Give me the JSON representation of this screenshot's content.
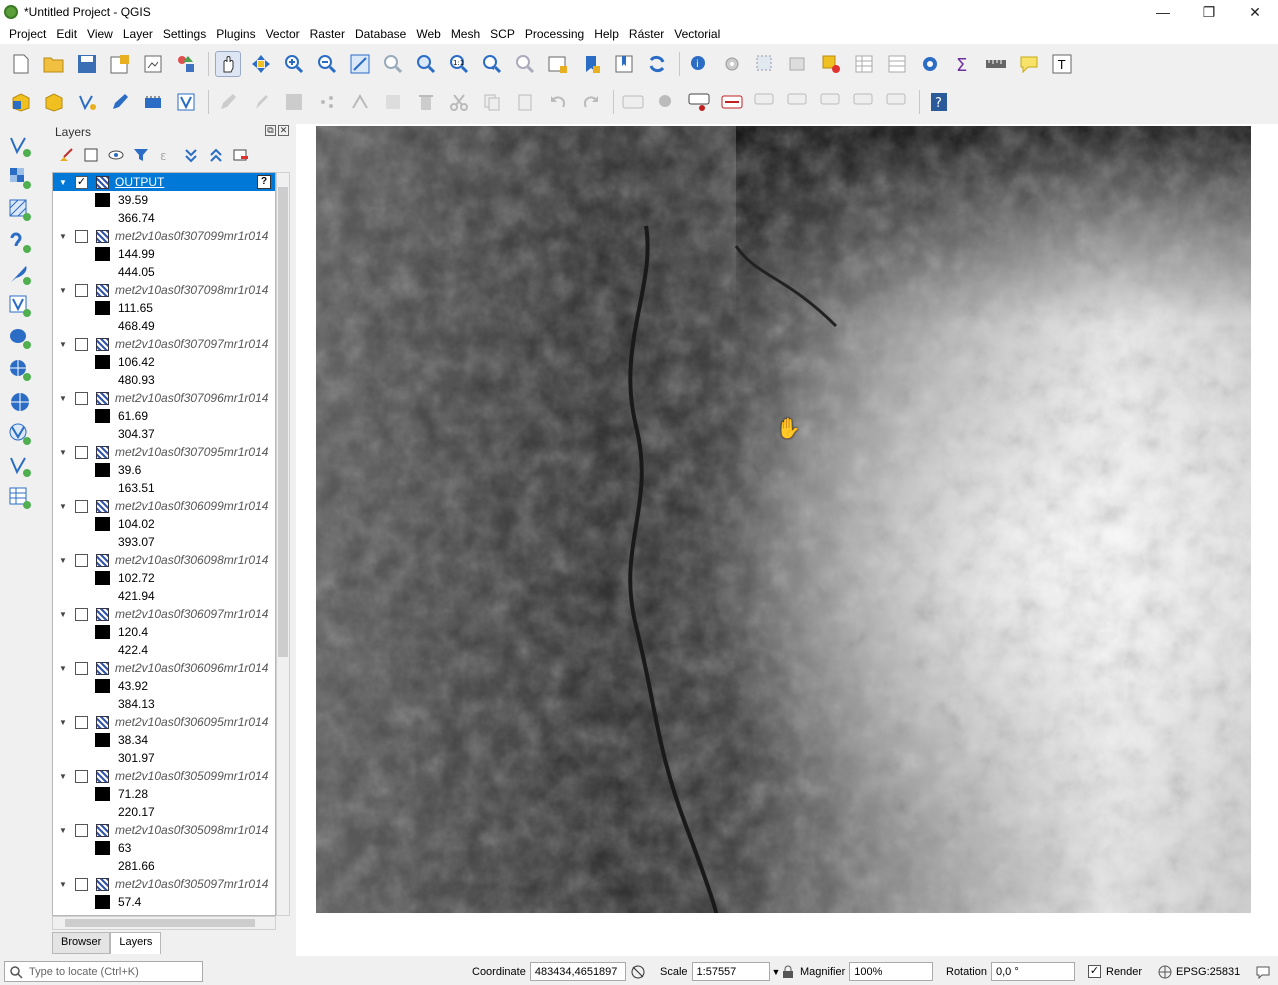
{
  "window": {
    "title": "*Untitled Project - QGIS",
    "minimize": "—",
    "restore": "❐",
    "close": "✕"
  },
  "menu": [
    "Project",
    "Edit",
    "View",
    "Layer",
    "Settings",
    "Plugins",
    "Vector",
    "Raster",
    "Database",
    "Web",
    "Mesh",
    "SCP",
    "Processing",
    "Help",
    "Ráster",
    "Vectorial"
  ],
  "panel": {
    "title": "Layers",
    "tabs": [
      "Browser",
      "Layers"
    ],
    "layers": [
      {
        "name": "OUTPUT",
        "checked": true,
        "selected": true,
        "min": "39.59",
        "max": "366.74"
      },
      {
        "name": "met2v10as0f307099mr1r014",
        "checked": false,
        "min": "144.99",
        "max": "444.05"
      },
      {
        "name": "met2v10as0f307098mr1r014",
        "checked": false,
        "min": "111.65",
        "max": "468.49"
      },
      {
        "name": "met2v10as0f307097mr1r014",
        "checked": false,
        "min": "106.42",
        "max": "480.93"
      },
      {
        "name": "met2v10as0f307096mr1r014",
        "checked": false,
        "min": "61.69",
        "max": "304.37"
      },
      {
        "name": "met2v10as0f307095mr1r014",
        "checked": false,
        "min": "39.6",
        "max": "163.51"
      },
      {
        "name": "met2v10as0f306099mr1r014",
        "checked": false,
        "min": "104.02",
        "max": "393.07"
      },
      {
        "name": "met2v10as0f306098mr1r014",
        "checked": false,
        "min": "102.72",
        "max": "421.94"
      },
      {
        "name": "met2v10as0f306097mr1r014",
        "checked": false,
        "min": "120.4",
        "max": "422.4"
      },
      {
        "name": "met2v10as0f306096mr1r014",
        "checked": false,
        "min": "43.92",
        "max": "384.13"
      },
      {
        "name": "met2v10as0f306095mr1r014",
        "checked": false,
        "min": "38.34",
        "max": "301.97"
      },
      {
        "name": "met2v10as0f305099mr1r014",
        "checked": false,
        "min": "71.28",
        "max": "220.17"
      },
      {
        "name": "met2v10as0f305098mr1r014",
        "checked": false,
        "min": "63",
        "max": "281.66"
      },
      {
        "name": "met2v10as0f305097mr1r014",
        "checked": false,
        "min": "57.4",
        "max": ""
      }
    ]
  },
  "status": {
    "locate_placeholder": "Type to locate (Ctrl+K)",
    "coordinate_label": "Coordinate",
    "coordinate_value": "483434,4651897",
    "scale_label": "Scale",
    "scale_value": "1:57557",
    "magnifier_label": "Magnifier",
    "magnifier_value": "100%",
    "rotation_label": "Rotation",
    "rotation_value": "0,0 °",
    "render_label": "Render",
    "crs": "EPSG:25831"
  },
  "colors": {
    "selection": "#0078d7",
    "accent_green": "#5a9e3a"
  }
}
